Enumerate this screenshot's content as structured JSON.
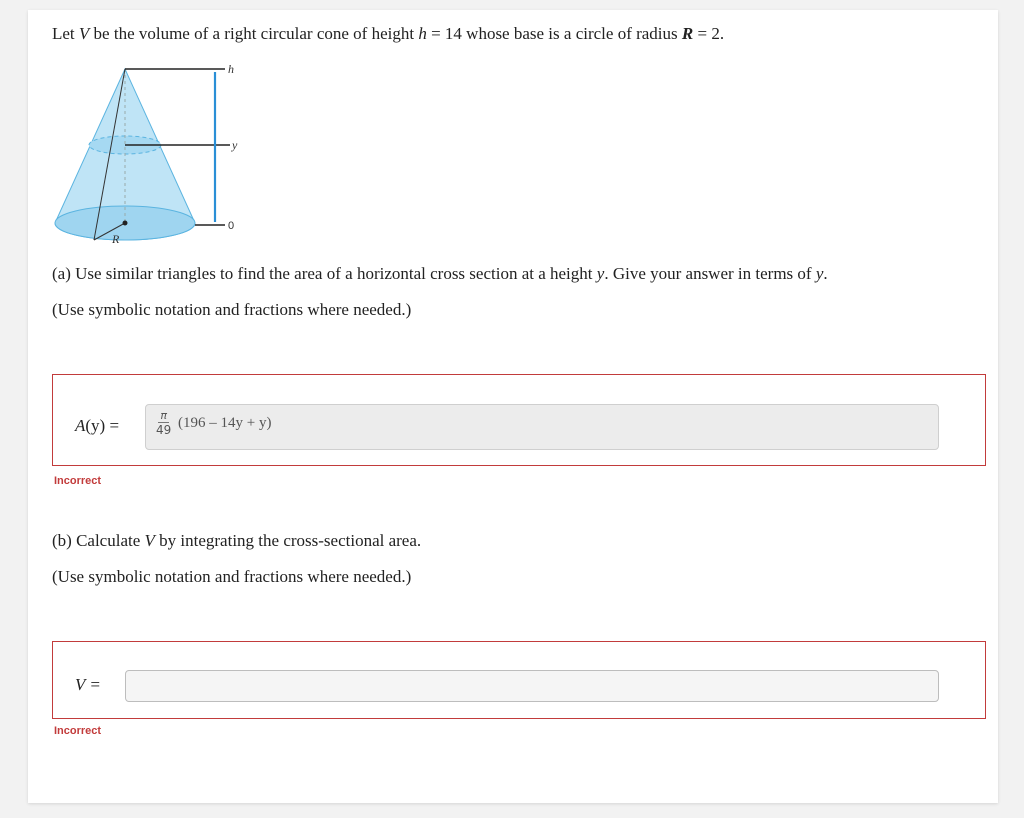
{
  "intro": {
    "t1": "Let ",
    "V": "V",
    "t2": " be the volume of a right circular cone of height ",
    "h": "h",
    "t3": " = 14 whose base is a circle of radius ",
    "R": "R",
    "t4": " = 2."
  },
  "figure": {
    "label_h": "h",
    "label_y": "y",
    "label_0": "0",
    "label_R": "R"
  },
  "part_a": {
    "prompt_1": "(a) Use similar triangles to find the area of a horizontal cross section at a height ",
    "var_y": "y",
    "prompt_2": ". Give your answer in terms of ",
    "var_y2": "y",
    "prompt_3": ".",
    "note": "(Use symbolic notation and fractions where needed.)",
    "label_A": "A",
    "label_paren": "(y) =",
    "frac_num": "π",
    "frac_den": "49",
    "expr": "(196 – 14y + y)",
    "status": "Incorrect"
  },
  "part_b": {
    "prompt_1": "(b) Calculate ",
    "var_V": "V",
    "prompt_2": " by integrating the cross-sectional area.",
    "note": "(Use symbolic notation and fractions where needed.)",
    "label": "V =",
    "value": "",
    "status": "Incorrect"
  },
  "colors": {
    "incorrect": "#c23b3b",
    "cone_fill": "#bfe4f6",
    "cone_edge": "#5bb4e0",
    "axis": "#2a8fd6"
  }
}
